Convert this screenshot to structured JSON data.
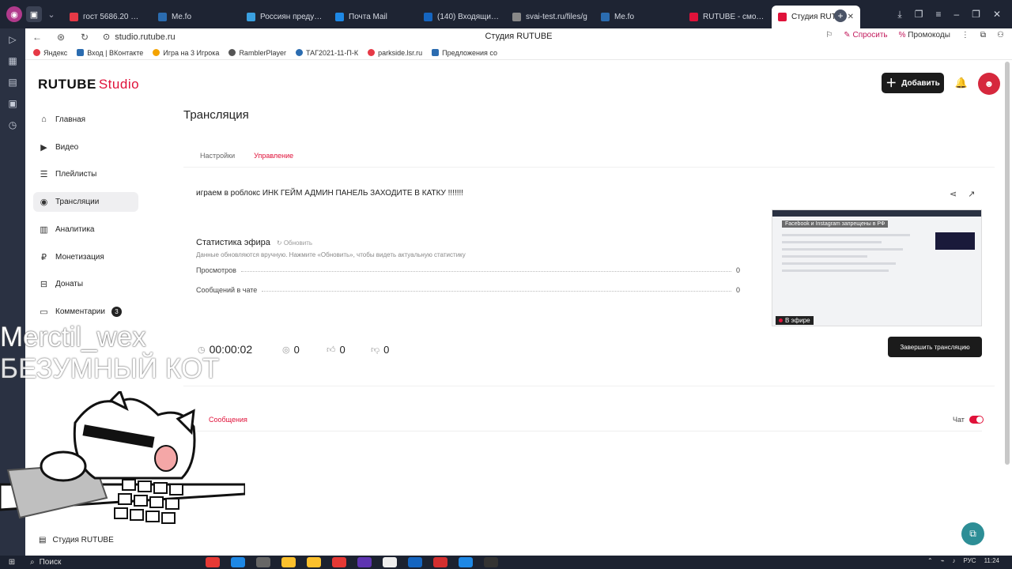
{
  "browser": {
    "tabs": [
      {
        "label": "гост 5686.20 — Янд",
        "color": "#e63946"
      },
      {
        "label": "Me.fo",
        "color": "#2b6cb0"
      },
      {
        "label": "Россиян предупре",
        "color": "#3aa0e0"
      },
      {
        "label": "Почта Mail",
        "color": "#1e88e5"
      },
      {
        "label": "(140) Входящие - П",
        "color": "#1565c0"
      },
      {
        "label": "svai-test.ru/files/g",
        "color": "#888888"
      },
      {
        "label": "Me.fo",
        "color": "#2b6cb0"
      },
      {
        "label": "RUTUBE - смотрит",
        "color": "#e0123a"
      },
      {
        "label": "Студия RUTU",
        "color": "#e0123a",
        "active": true
      }
    ],
    "url": "studio.rutube.ru",
    "page_title": "Студия RUTUBE",
    "ask_label": "Спросить",
    "promo_label": "Промокоды",
    "bookmarks": [
      {
        "label": "Яндекс",
        "color": "#e63946"
      },
      {
        "label": "Вход | ВКонтакте",
        "color": "#2b6cb0"
      },
      {
        "label": "Игра на 3 Игрока",
        "color": "#f4a300"
      },
      {
        "label": "RamblerPlayer",
        "color": "#555555"
      },
      {
        "label": "ТАГ2021-11-П-К",
        "color": "#2b6cb0"
      },
      {
        "label": "parkside.lsr.ru",
        "color": "#e63946"
      },
      {
        "label": "Предложения со",
        "color": "#2b6cb0"
      }
    ]
  },
  "app": {
    "logo_main": "RUTUBE",
    "logo_studio": "Studio",
    "add_button": "Добавить",
    "nav": [
      {
        "label": "Главная",
        "icon": "home-icon"
      },
      {
        "label": "Видео",
        "icon": "video-icon"
      },
      {
        "label": "Плейлисты",
        "icon": "playlist-icon"
      },
      {
        "label": "Трансляции",
        "icon": "broadcast-icon",
        "active": true
      },
      {
        "label": "Аналитика",
        "icon": "analytics-icon"
      },
      {
        "label": "Монетизация",
        "icon": "monetization-icon"
      },
      {
        "label": "Донаты",
        "icon": "donate-icon"
      },
      {
        "label": "Комментарии",
        "icon": "comments-icon",
        "badge": "3"
      }
    ],
    "nav_bottom": "Студия RUTUBE",
    "page_title": "Трансляция",
    "content_tabs": [
      {
        "label": "Настройки"
      },
      {
        "label": "Управление",
        "active": true
      }
    ],
    "stream_title": "играем в роблокс ИНК ГЕЙМ АДМИН ПАНЕЛЬ ЗАХОДИТЕ В КАТКУ !!!!!!!",
    "stats": {
      "title": "Статистика эфира",
      "refresh": "Обновить",
      "hint": "Данные обновляются вручную. Нажмите «Обновить», чтобы видеть актуальную статистику",
      "rows": [
        {
          "label": "Просмотров",
          "value": "0"
        },
        {
          "label": "Сообщений в чате",
          "value": "0"
        }
      ]
    },
    "preview": {
      "banner": "Facebook и Instagram запрещены в РФ",
      "live_label": "В эфире"
    },
    "end_button": "Завершить трансляцию",
    "metrics": {
      "timer": "00:00:02",
      "viewers": "0",
      "likes": "0",
      "dislikes": "0"
    },
    "chat": {
      "tab": "Сообщения",
      "toggle_label": "Чат"
    }
  },
  "overlay": {
    "name": "Merctil_wex",
    "subtitle": "БЕЗУМНЫЙ КОТ"
  },
  "taskbar": {
    "search": "Поиск",
    "lang": "РУС",
    "time": "11:24"
  },
  "colors": {
    "accent": "#e0123a",
    "dark_button": "#1b1b1b"
  }
}
